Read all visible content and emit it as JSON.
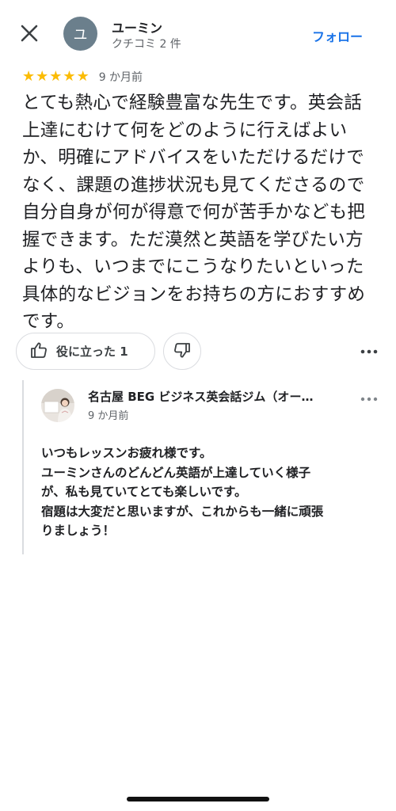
{
  "header": {
    "close_icon": "close-icon",
    "avatar_letter": "ユ",
    "user_name": "ユーミン",
    "user_sub": "クチコミ 2 件",
    "follow_label": "フォロー"
  },
  "review": {
    "rating": 5,
    "rating_max": 5,
    "stars": [
      "★",
      "★",
      "★",
      "★",
      "★"
    ],
    "time": "9 か月前",
    "text": "とても熱心で経験豊富な先生です。英会話上達にむけて何をどのように行えばよいか、明確にアドバイスをいただけるだけでなく、課題の進捗状況も見てくださるので自分自身が何が得意で何が苦手かなども把握できます。ただ漠然と英語を学びたい方よりも、いつまでにこうなりたいといった具体的なビジョンをお持ちの方におすすめです。"
  },
  "actions": {
    "helpful_label": "役に立った 1",
    "helpful_icon": "thumbs-up-icon",
    "dislike_icon": "thumbs-down-icon",
    "more_icon": "more-horizontal-icon"
  },
  "owner_reply": {
    "name": "名古屋 BEG ビジネス英会話ジム（オー…",
    "time": "9 か月前",
    "lines": [
      "いつもレッスンお疲れ様です。",
      "ユーミンさんのどんどん英語が上達していく様子",
      "が、私も見ていてとても楽しいです。",
      "宿題は大変だと思いますが、これからも一緒に頑張",
      "りましょう！"
    ],
    "more_icon": "more-horizontal-icon"
  },
  "colors": {
    "accent": "#1a73e8",
    "star": "#fbbc04",
    "avatar_bg": "#6b7f8c",
    "border": "#dadce0",
    "text_secondary": "#5f6368"
  }
}
